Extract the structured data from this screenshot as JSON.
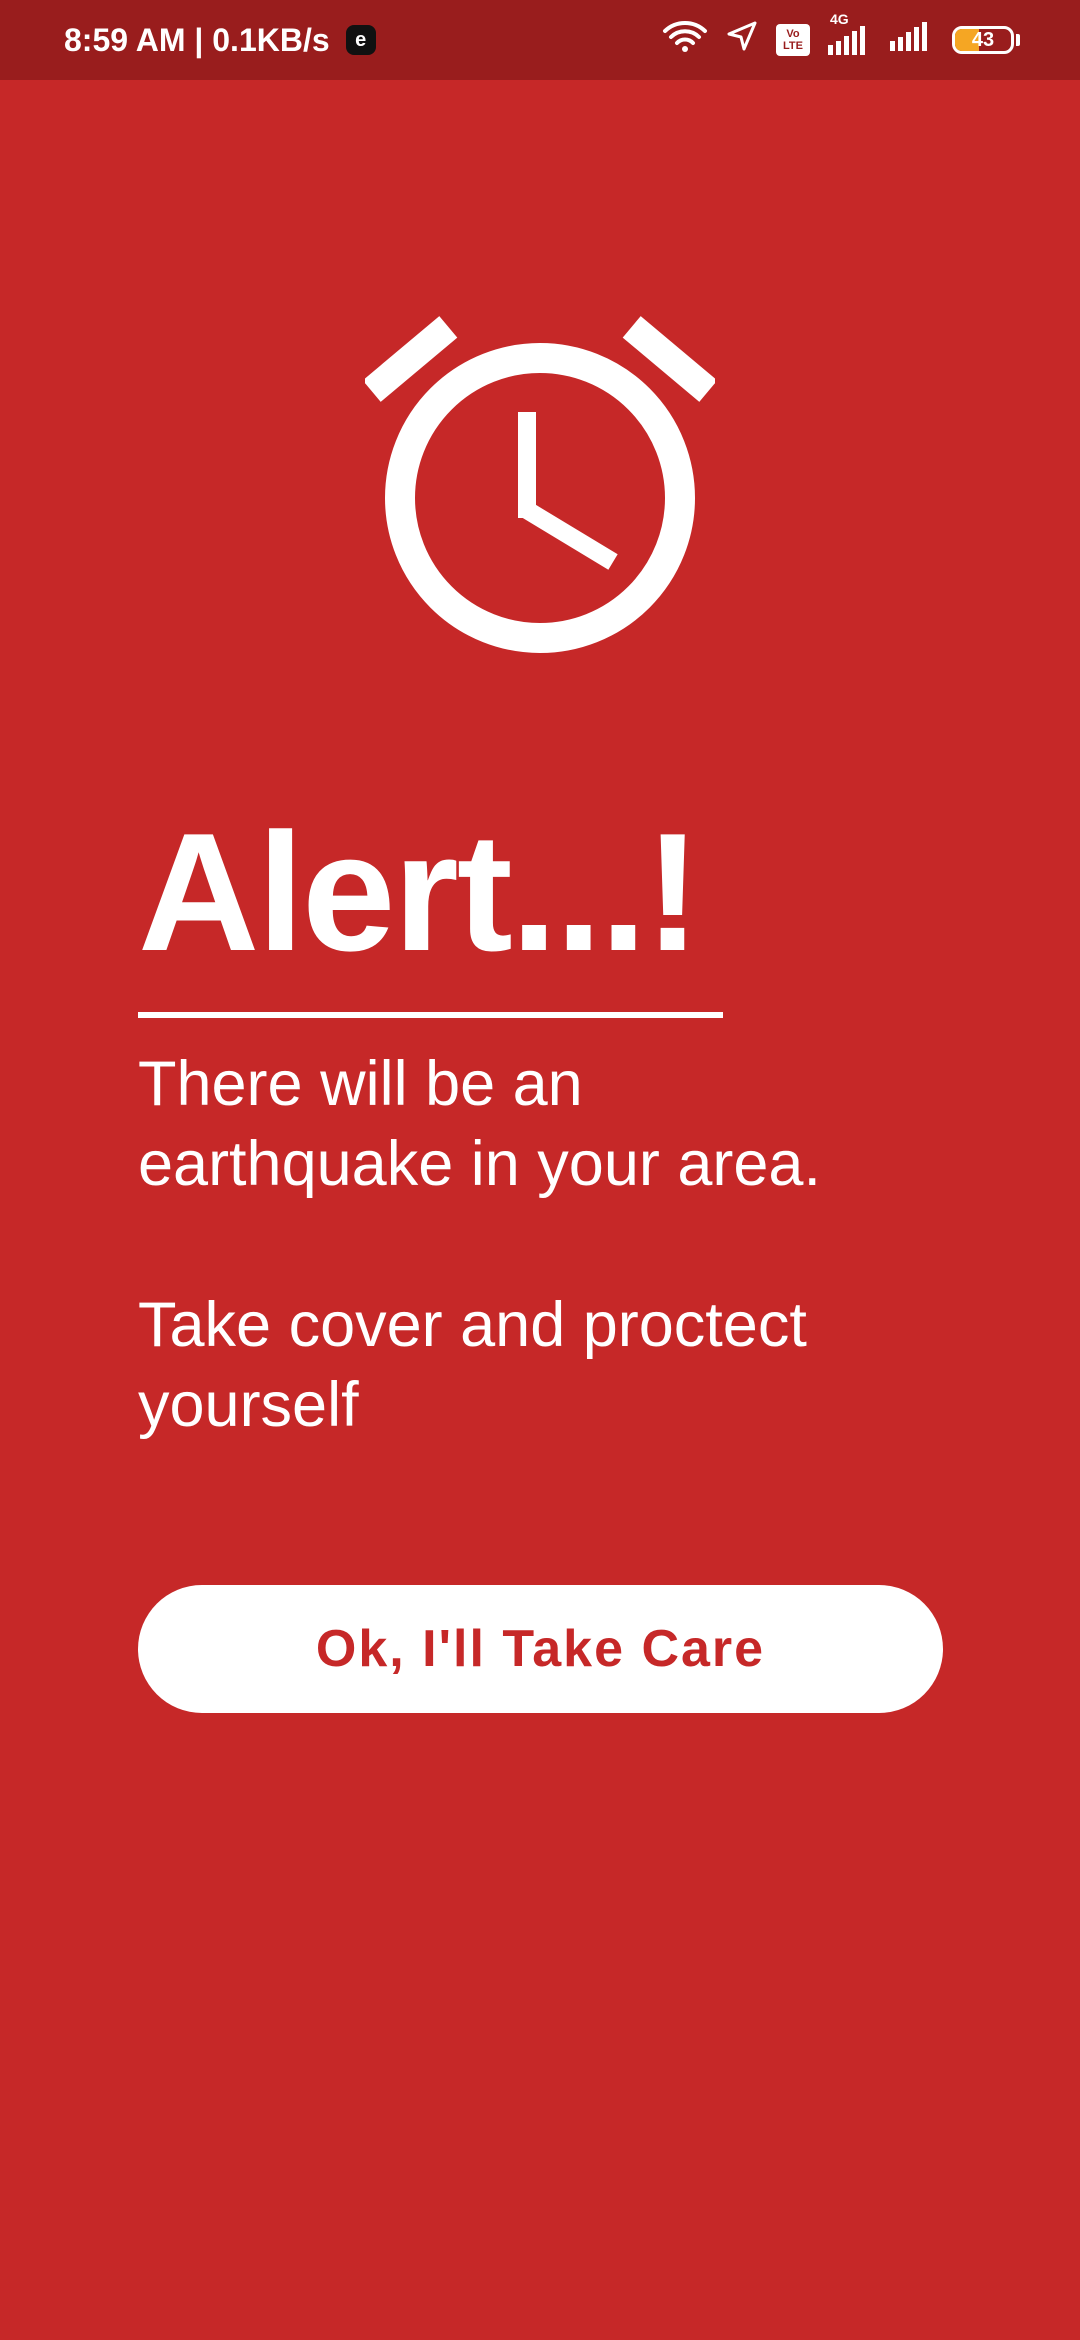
{
  "status_bar": {
    "time_speed": "8:59 AM | 0.1KB/s",
    "app_badge": "e",
    "volte_top": "Vo",
    "volte_bottom": "LTE",
    "network_type": "4G",
    "battery_level": "43",
    "battery_fraction": 0.43
  },
  "alert": {
    "title": "Alert...!",
    "message_line1": "There will be an",
    "message_line2": "earthquake in your area.",
    "instruction_line1": "Take cover and proctect",
    "instruction_line2": "yourself",
    "button_label": "Ok, I'll Take Care"
  },
  "colors": {
    "background": "#c62828",
    "status_bar": "#991d1d",
    "foreground": "#ffffff",
    "battery_accent": "#f5a623"
  },
  "icons": {
    "hero": "alarm-clock-icon",
    "status": [
      "wifi-icon",
      "location-arrow-icon",
      "volte-icon",
      "signal-icon",
      "battery-icon"
    ]
  }
}
